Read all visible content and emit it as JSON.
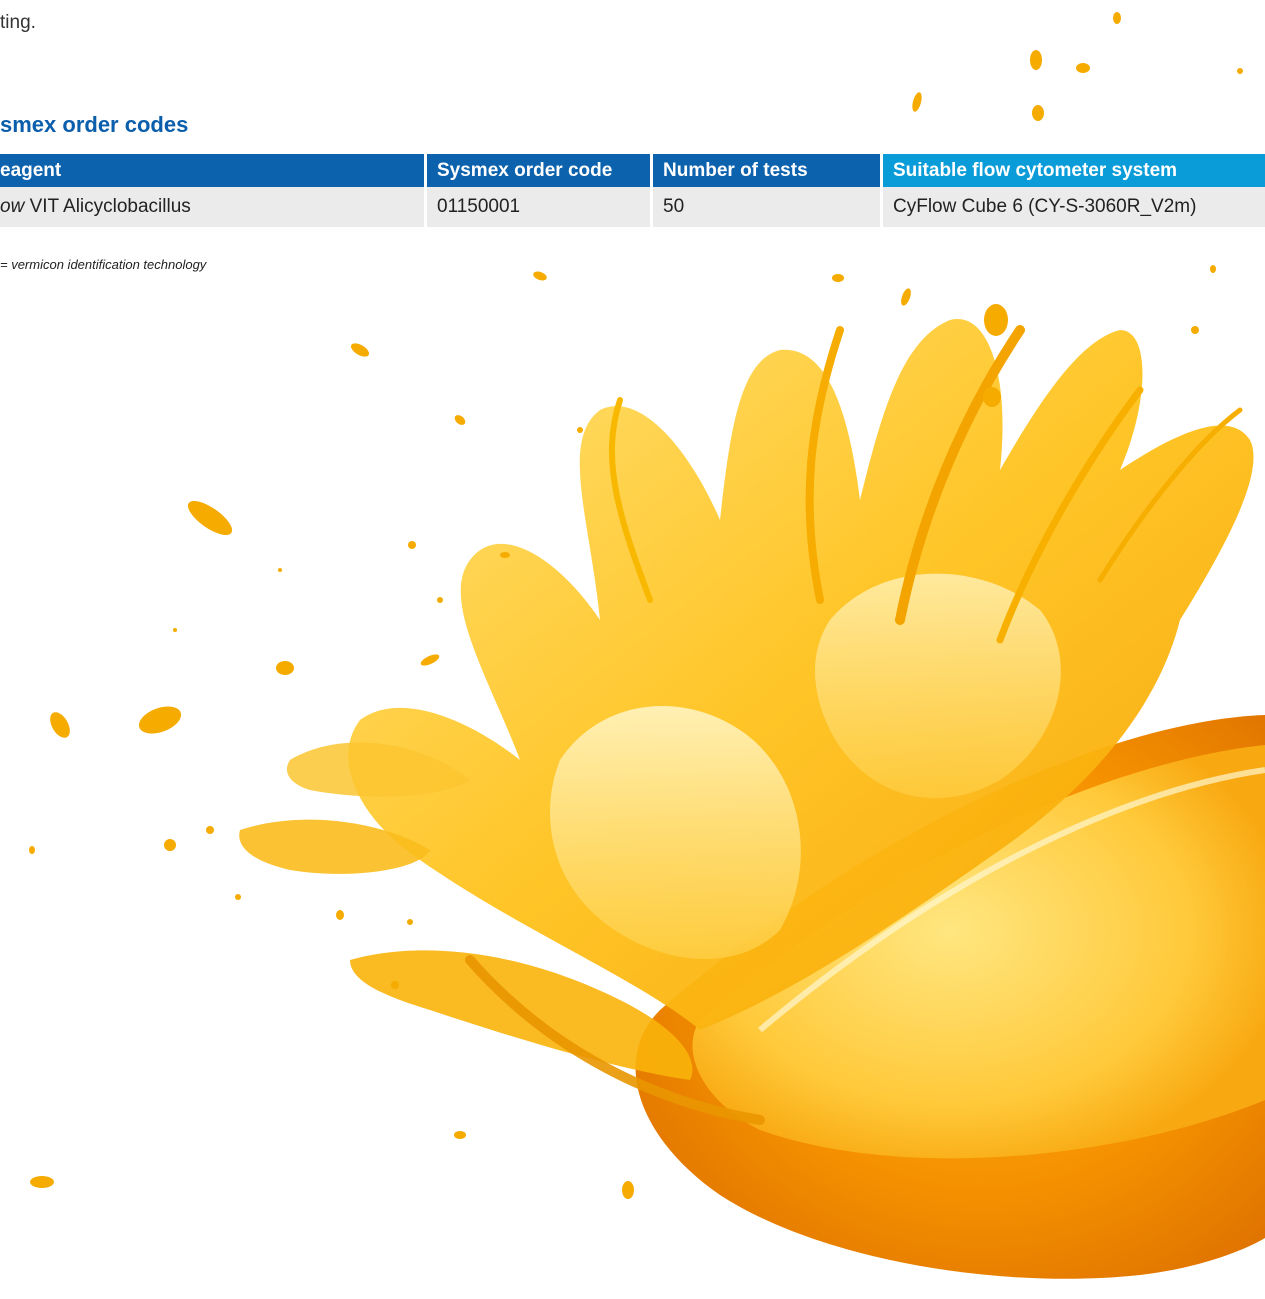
{
  "document": {
    "intro_text": "ting.",
    "section_heading": "smex order codes",
    "table": {
      "headers": [
        "eagent",
        "Sysmex order code",
        "Number of tests",
        "Suitable flow cytometer system"
      ],
      "rows": [
        {
          "reagent_prefix": "ow",
          "reagent_name": " VIT Alicyclobacillus",
          "order_code": "01150001",
          "tests": "50",
          "system": "CyFlow Cube 6 (CY-S-3060R_V2m)"
        }
      ]
    },
    "footnote": "= vermicon identification technology"
  },
  "image": {
    "subject": "orange-juice-splash",
    "colors": {
      "heading": "#0a5eab",
      "header_dark": "#0d62ad",
      "header_light": "#0a9cd8",
      "row_bg": "#ebebeb",
      "juice": "#f7b500",
      "orange_peel": "#f28a00"
    }
  }
}
